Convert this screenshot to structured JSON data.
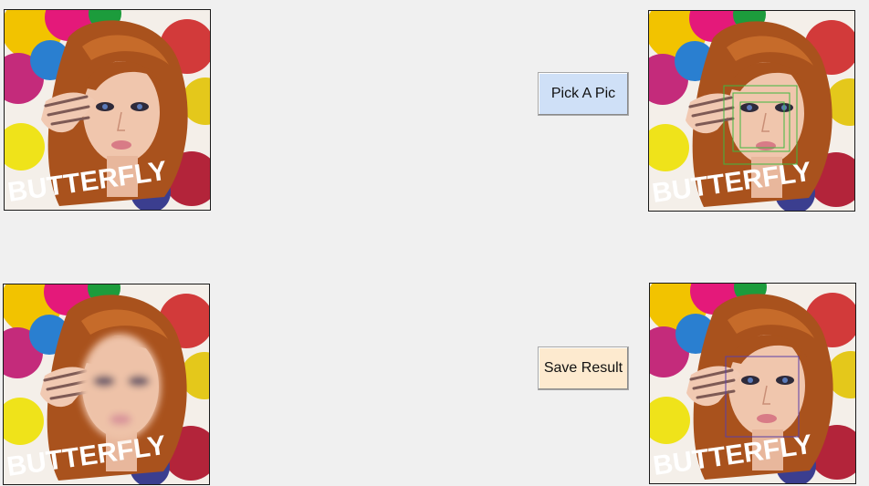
{
  "buttons": {
    "pick_label": "Pick A Pic",
    "save_label": "Save Result"
  },
  "images": {
    "original": "original photo",
    "detected": "face detection result",
    "blurred": "blurred face image",
    "result": "final result image"
  },
  "picture_text": "BUTTERFLY",
  "colors": {
    "pick_button_bg": "#cfe0f7",
    "save_button_bg": "#fdeacf",
    "detect_box": "#3fb83f",
    "result_box": "#5a3fa6"
  }
}
